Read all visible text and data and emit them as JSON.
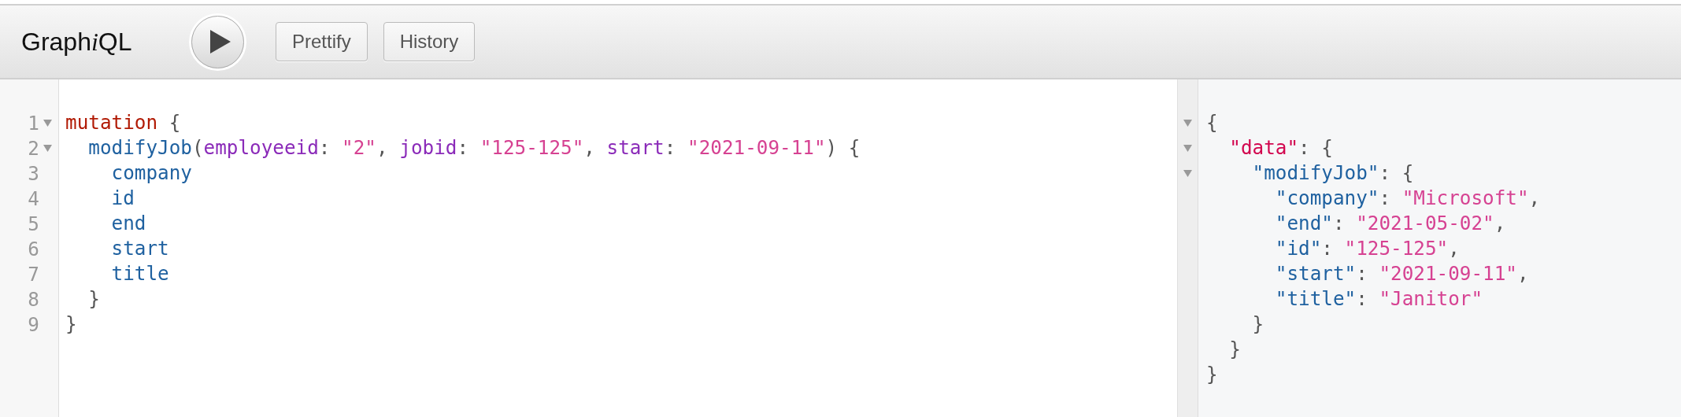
{
  "toolbar": {
    "logo": [
      {
        "text": "Graph",
        "italic": false
      },
      {
        "text": "i",
        "italic": true
      },
      {
        "text": "QL",
        "italic": false
      }
    ],
    "buttons": [
      {
        "label": "Prettify"
      },
      {
        "label": "History"
      }
    ]
  },
  "query_editor": {
    "lines": [
      {
        "number": "1",
        "foldable": true,
        "tokens": [
          {
            "kind": "keyword",
            "text": "mutation"
          },
          {
            "kind": "punctuation",
            "text": " {"
          }
        ]
      },
      {
        "number": "2",
        "foldable": true,
        "tokens": [
          {
            "kind": "property",
            "text": "  modifyJob"
          },
          {
            "kind": "punctuation",
            "text": "("
          },
          {
            "kind": "attribute",
            "text": "employeeid"
          },
          {
            "kind": "punctuation",
            "text": ": "
          },
          {
            "kind": "string",
            "text": "\"2\""
          },
          {
            "kind": "punctuation",
            "text": ", "
          },
          {
            "kind": "attribute",
            "text": "jobid"
          },
          {
            "kind": "punctuation",
            "text": ": "
          },
          {
            "kind": "string",
            "text": "\"125-125\""
          },
          {
            "kind": "punctuation",
            "text": ", "
          },
          {
            "kind": "attribute",
            "text": "start"
          },
          {
            "kind": "punctuation",
            "text": ": "
          },
          {
            "kind": "string",
            "text": "\"2021-09-11\""
          },
          {
            "kind": "punctuation",
            "text": ") {"
          }
        ]
      },
      {
        "number": "3",
        "foldable": false,
        "tokens": [
          {
            "kind": "property",
            "text": "    company"
          }
        ]
      },
      {
        "number": "4",
        "foldable": false,
        "tokens": [
          {
            "kind": "property",
            "text": "    id"
          }
        ]
      },
      {
        "number": "5",
        "foldable": false,
        "tokens": [
          {
            "kind": "property",
            "text": "    end"
          }
        ]
      },
      {
        "number": "6",
        "foldable": false,
        "tokens": [
          {
            "kind": "property",
            "text": "    start"
          }
        ]
      },
      {
        "number": "7",
        "foldable": false,
        "tokens": [
          {
            "kind": "property",
            "text": "    title"
          }
        ]
      },
      {
        "number": "8",
        "foldable": false,
        "tokens": [
          {
            "kind": "punctuation",
            "text": "  }"
          }
        ]
      },
      {
        "number": "9",
        "foldable": false,
        "tokens": [
          {
            "kind": "punctuation",
            "text": "}"
          }
        ]
      }
    ]
  },
  "result_viewer": {
    "lines": [
      {
        "foldable": true,
        "tokens": [
          {
            "kind": "punctuation",
            "text": "{"
          }
        ]
      },
      {
        "foldable": true,
        "tokens": [
          {
            "kind": "data-key",
            "text": "  \"data\""
          },
          {
            "kind": "punctuation",
            "text": ": {"
          }
        ]
      },
      {
        "foldable": true,
        "tokens": [
          {
            "kind": "property",
            "text": "    \"modifyJob\""
          },
          {
            "kind": "punctuation",
            "text": ": {"
          }
        ]
      },
      {
        "foldable": false,
        "tokens": [
          {
            "kind": "property",
            "text": "      \"company\""
          },
          {
            "kind": "punctuation",
            "text": ": "
          },
          {
            "kind": "string",
            "text": "\"Microsoft\""
          },
          {
            "kind": "punctuation",
            "text": ","
          }
        ]
      },
      {
        "foldable": false,
        "tokens": [
          {
            "kind": "property",
            "text": "      \"end\""
          },
          {
            "kind": "punctuation",
            "text": ": "
          },
          {
            "kind": "string",
            "text": "\"2021-05-02\""
          },
          {
            "kind": "punctuation",
            "text": ","
          }
        ]
      },
      {
        "foldable": false,
        "tokens": [
          {
            "kind": "property",
            "text": "      \"id\""
          },
          {
            "kind": "punctuation",
            "text": ": "
          },
          {
            "kind": "string",
            "text": "\"125-125\""
          },
          {
            "kind": "punctuation",
            "text": ","
          }
        ]
      },
      {
        "foldable": false,
        "tokens": [
          {
            "kind": "property",
            "text": "      \"start\""
          },
          {
            "kind": "punctuation",
            "text": ": "
          },
          {
            "kind": "string",
            "text": "\"2021-09-11\""
          },
          {
            "kind": "punctuation",
            "text": ","
          }
        ]
      },
      {
        "foldable": false,
        "tokens": [
          {
            "kind": "property",
            "text": "      \"title\""
          },
          {
            "kind": "punctuation",
            "text": ": "
          },
          {
            "kind": "string",
            "text": "\"Janitor\""
          }
        ]
      },
      {
        "foldable": false,
        "tokens": [
          {
            "kind": "punctuation",
            "text": "    }"
          }
        ]
      },
      {
        "foldable": false,
        "tokens": [
          {
            "kind": "punctuation",
            "text": "  }"
          }
        ]
      },
      {
        "foldable": false,
        "tokens": [
          {
            "kind": "punctuation",
            "text": "}"
          }
        ]
      }
    ]
  }
}
